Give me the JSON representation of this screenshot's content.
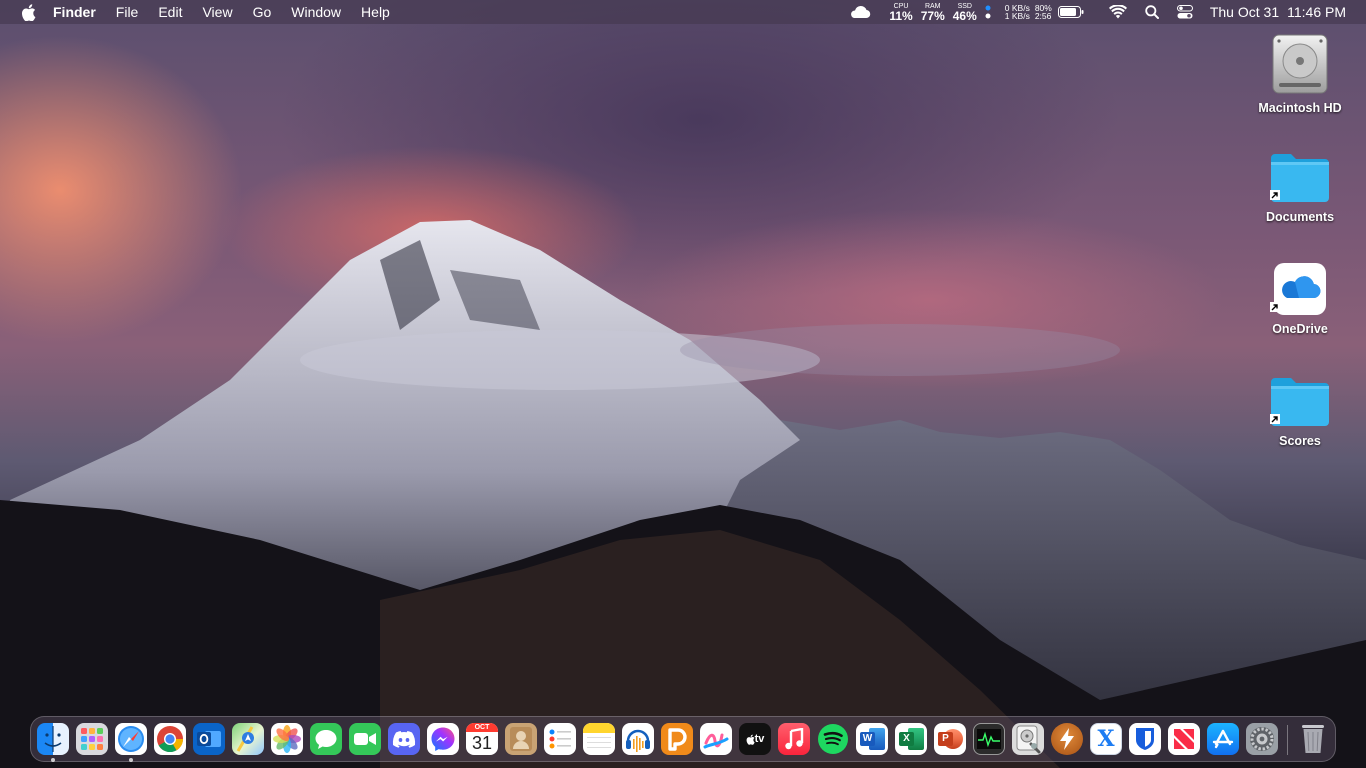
{
  "menubar": {
    "app_name": "Finder",
    "menus": [
      "File",
      "Edit",
      "View",
      "Go",
      "Window",
      "Help"
    ],
    "stats": {
      "cpu_label": "CPU",
      "cpu_value": "11%",
      "ram_label": "RAM",
      "ram_value": "77%",
      "ssd_label": "SSD",
      "ssd_value": "46%"
    },
    "network": {
      "upload": "0 KB/s",
      "download": "1 KB/s"
    },
    "battery": {
      "percent": "80%",
      "time": "2:56"
    },
    "clock": {
      "date": "Thu Oct 31",
      "time": "11:46 PM"
    }
  },
  "desktop": {
    "icons": [
      {
        "label": "Macintosh HD",
        "icon": "hard-drive-icon"
      },
      {
        "label": "Documents",
        "icon": "folder-icon"
      },
      {
        "label": "OneDrive",
        "icon": "onedrive-icon"
      },
      {
        "label": "Scores",
        "icon": "folder-icon"
      }
    ]
  },
  "dock": {
    "calendar": {
      "month": "OCT",
      "day": "31"
    },
    "tv_label": "tv",
    "word_letter": "W",
    "excel_letter": "X",
    "powerpoint_letter": "P",
    "xcode_letter": "X",
    "apps": [
      "finder",
      "launchpad",
      "safari",
      "chrome",
      "outlook",
      "maps",
      "photos",
      "messages",
      "facetime",
      "discord",
      "messenger",
      "calendar",
      "contacts",
      "reminders",
      "notes",
      "audacity",
      "pockity",
      "freeform",
      "apple-tv",
      "music",
      "spotify",
      "word",
      "excel",
      "powerpoint",
      "activity-monitor",
      "disk-utility",
      "reeder",
      "xcode",
      "bitwarden",
      "news",
      "app-store",
      "system-settings",
      "trash"
    ],
    "colors": {
      "accent_blue": "#1f8fff",
      "folder": "#39b8f0"
    }
  }
}
